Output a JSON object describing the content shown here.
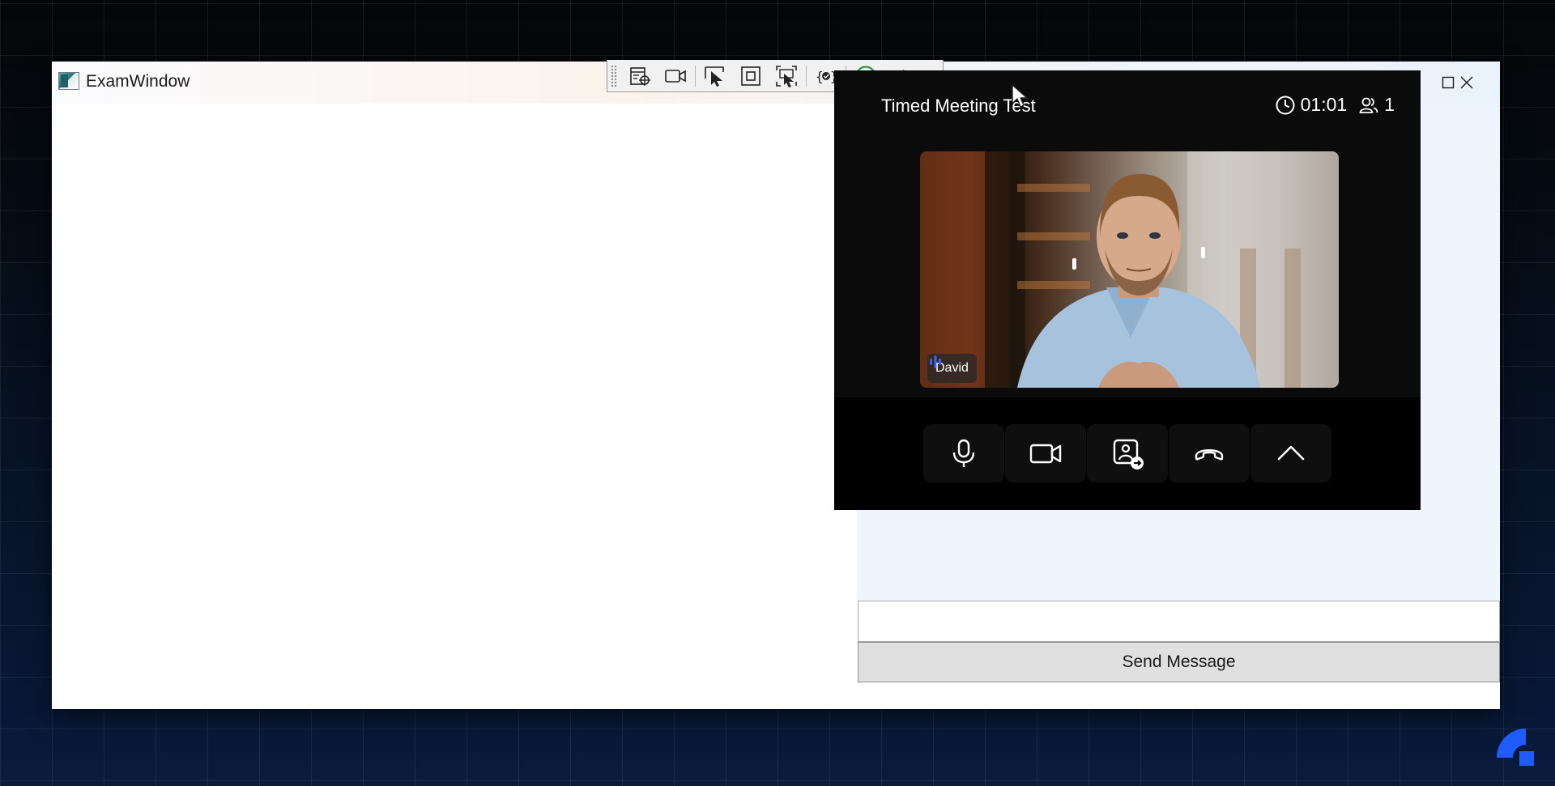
{
  "window": {
    "title": "ExamWindow",
    "icon": "app-window-icon",
    "controls": [
      "minimize-icon",
      "maximize-icon",
      "close-icon"
    ]
  },
  "debug_toolbar": {
    "icons": [
      "select-element-icon",
      "record-icon",
      "pointer-select-icon",
      "bounds-icon",
      "track-focus-icon",
      "bindings-icon",
      "accessibility-check-icon",
      "collapse-icon"
    ],
    "check_color": "#2e9b3e"
  },
  "meeting": {
    "title": "Timed Meeting Test",
    "timer": "01:01",
    "participants": "1",
    "participant_name": "David",
    "accent": "#3b63f5",
    "controls": [
      "microphone-icon",
      "camera-icon",
      "share-screen-icon",
      "hang-up-icon",
      "more-options-icon"
    ]
  },
  "chat": {
    "input_value": "",
    "send_label": "Send Message"
  }
}
